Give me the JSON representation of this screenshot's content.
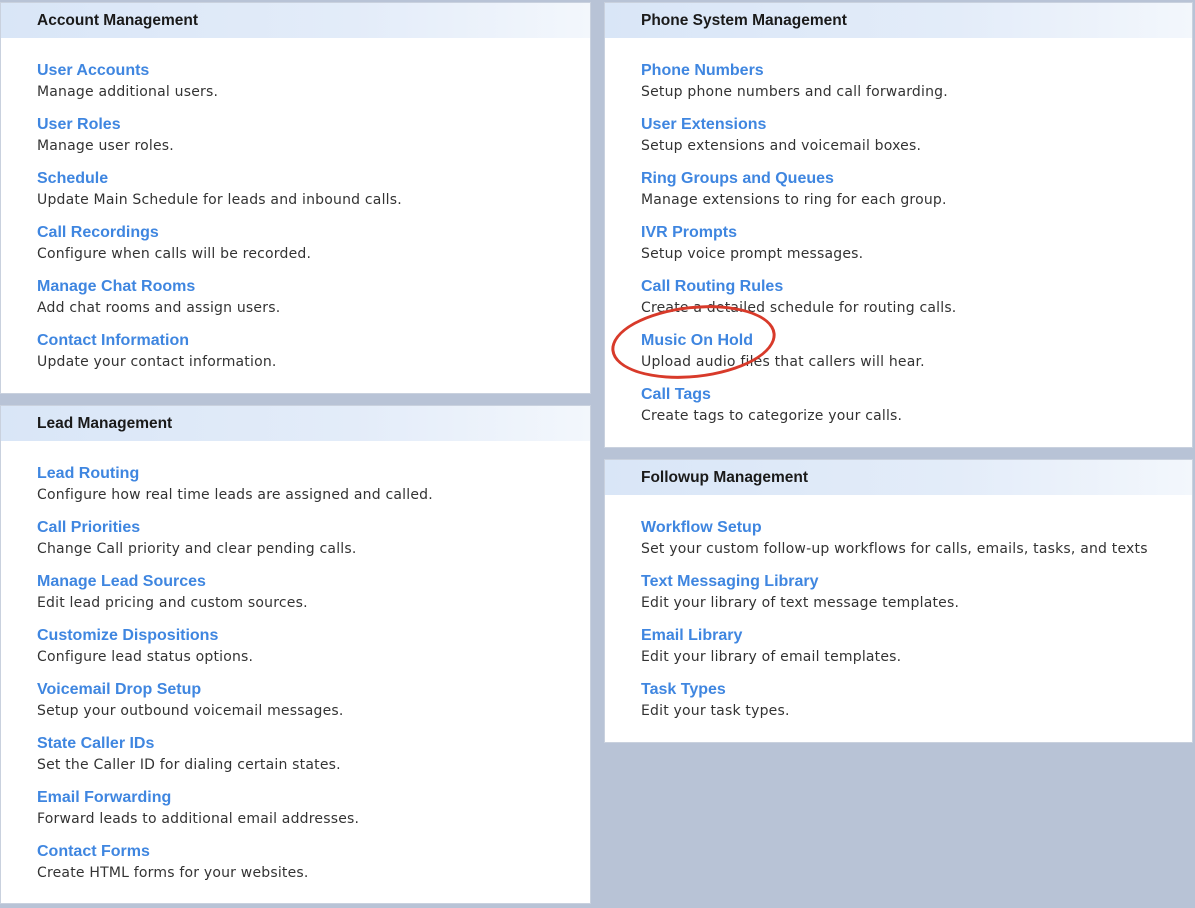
{
  "panels": {
    "account": {
      "title": "Account Management",
      "items": [
        {
          "label": "User Accounts",
          "desc": "Manage additional users."
        },
        {
          "label": "User Roles",
          "desc": "Manage user roles."
        },
        {
          "label": "Schedule",
          "desc": "Update Main Schedule for leads and inbound calls."
        },
        {
          "label": "Call Recordings",
          "desc": "Configure when calls will be recorded."
        },
        {
          "label": "Manage Chat Rooms",
          "desc": "Add chat rooms and assign users."
        },
        {
          "label": "Contact Information",
          "desc": "Update your contact information."
        }
      ]
    },
    "lead": {
      "title": "Lead Management",
      "items": [
        {
          "label": "Lead Routing",
          "desc": "Configure how real time leads are assigned and called."
        },
        {
          "label": "Call Priorities",
          "desc": "Change Call priority and clear pending calls."
        },
        {
          "label": "Manage Lead Sources",
          "desc": "Edit lead pricing and custom sources."
        },
        {
          "label": "Customize Dispositions",
          "desc": "Configure lead status options."
        },
        {
          "label": "Voicemail Drop Setup",
          "desc": "Setup your outbound voicemail messages."
        },
        {
          "label": "State Caller IDs",
          "desc": "Set the Caller ID for dialing certain states."
        },
        {
          "label": "Email Forwarding",
          "desc": "Forward leads to additional email addresses."
        },
        {
          "label": "Contact Forms",
          "desc": "Create HTML forms for your websites."
        }
      ]
    },
    "phone": {
      "title": "Phone System Management",
      "items": [
        {
          "label": "Phone Numbers",
          "desc": "Setup phone numbers and call forwarding."
        },
        {
          "label": "User Extensions",
          "desc": "Setup extensions and voicemail boxes."
        },
        {
          "label": "Ring Groups and Queues",
          "desc": "Manage extensions to ring for each group."
        },
        {
          "label": "IVR Prompts",
          "desc": "Setup voice prompt messages."
        },
        {
          "label": "Call Routing Rules",
          "desc": "Create a detailed schedule for routing calls."
        },
        {
          "label": "Music On Hold",
          "desc": "Upload audio files that callers will hear."
        },
        {
          "label": "Call Tags",
          "desc": "Create tags to categorize your calls."
        }
      ]
    },
    "followup": {
      "title": "Followup Management",
      "items": [
        {
          "label": "Workflow Setup",
          "desc": "Set your custom follow-up workflows for calls, emails, tasks, and texts"
        },
        {
          "label": "Text Messaging Library",
          "desc": "Edit your library of text message templates."
        },
        {
          "label": "Email Library",
          "desc": "Edit your library of email templates."
        },
        {
          "label": "Task Types",
          "desc": "Edit your task types."
        }
      ]
    }
  },
  "colors": {
    "page_background": "#b8c3d6",
    "link": "#3f86e0",
    "header_background": "#dce8f8",
    "highlight_ring": "#d83a2a"
  }
}
